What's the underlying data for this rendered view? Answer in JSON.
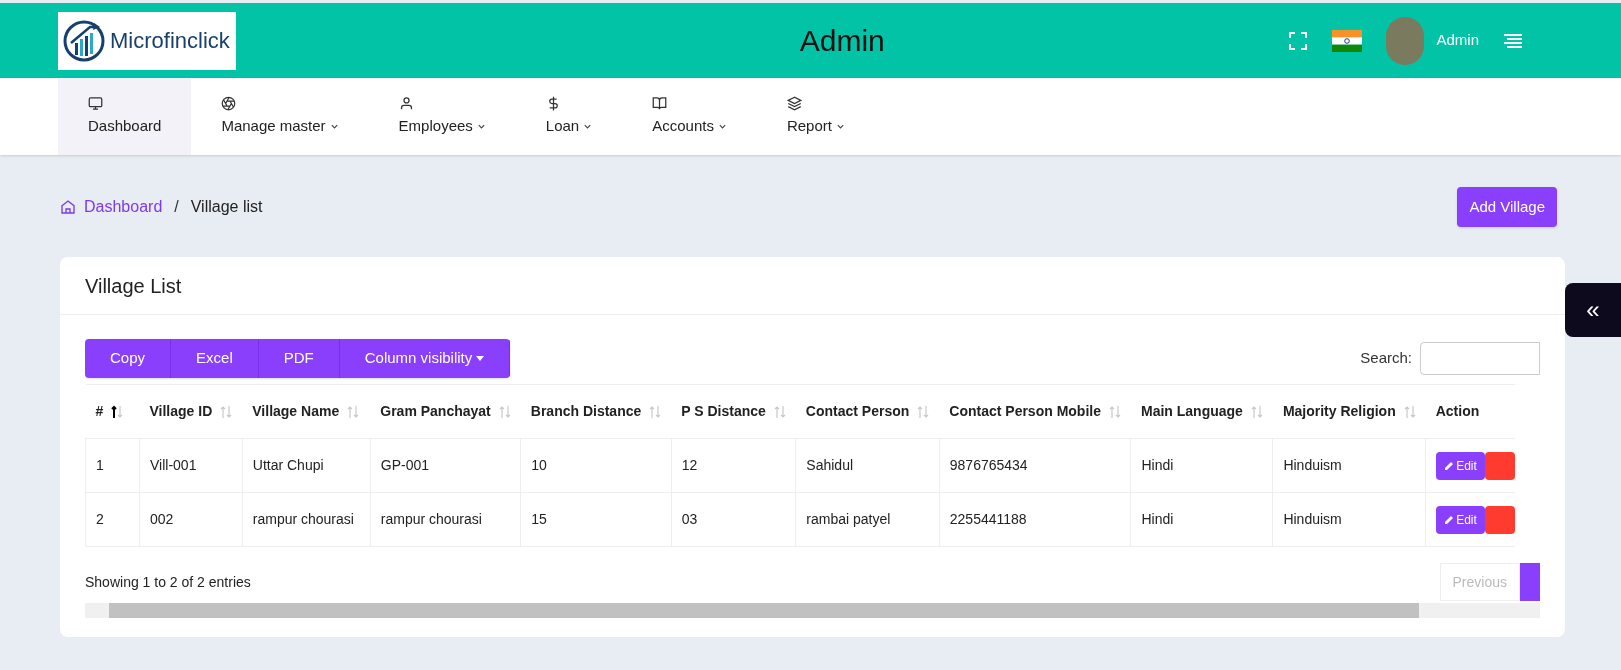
{
  "header": {
    "logo_text": "Microfinclick",
    "title": "Admin",
    "user_name": "Admin"
  },
  "nav": [
    {
      "label": "Dashboard",
      "dropdown": false,
      "selected": true
    },
    {
      "label": "Manage master",
      "dropdown": true,
      "selected": false
    },
    {
      "label": "Employees",
      "dropdown": true,
      "selected": false
    },
    {
      "label": "Loan",
      "dropdown": true,
      "selected": false
    },
    {
      "label": "Accounts",
      "dropdown": true,
      "selected": false
    },
    {
      "label": "Report",
      "dropdown": true,
      "selected": false
    }
  ],
  "breadcrumb": {
    "home": "Dashboard",
    "separator": "/",
    "current": "Village list"
  },
  "add_button": "Add Village",
  "side_toggle": "«",
  "card": {
    "title": "Village List",
    "export_buttons": [
      {
        "label": "Copy",
        "dropdown": false
      },
      {
        "label": "Excel",
        "dropdown": false
      },
      {
        "label": "PDF",
        "dropdown": false
      },
      {
        "label": "Column visibility",
        "dropdown": true
      }
    ],
    "search_label": "Search:",
    "table": {
      "columns": [
        {
          "label": "#",
          "sortable": true,
          "sorted": true
        },
        {
          "label": "Village ID",
          "sortable": true,
          "sorted": false
        },
        {
          "label": "Village Name",
          "sortable": true,
          "sorted": false
        },
        {
          "label": "Gram Panchayat",
          "sortable": true,
          "sorted": false
        },
        {
          "label": "Branch Distance",
          "sortable": true,
          "sorted": false
        },
        {
          "label": "P S Distance",
          "sortable": true,
          "sorted": false
        },
        {
          "label": "Contact Person",
          "sortable": true,
          "sorted": false
        },
        {
          "label": "Contact Person Mobile",
          "sortable": true,
          "sorted": false
        },
        {
          "label": "Main Language",
          "sortable": true,
          "sorted": false
        },
        {
          "label": "Majority Religion",
          "sortable": true,
          "sorted": false
        },
        {
          "label": "Action",
          "sortable": false,
          "sorted": false
        }
      ],
      "rows": [
        {
          "cells": [
            "1",
            "Vill-001",
            "Uttar Chupi",
            "GP-001",
            "10",
            "12",
            "Sahidul",
            "9876765434",
            "Hindi",
            "Hinduism"
          ],
          "edit": "Edit"
        },
        {
          "cells": [
            "2",
            "002",
            "rampur chourasi",
            "rampur chourasi",
            "15",
            "03",
            "rambai patyel",
            "2255441188",
            "Hindi",
            "Hinduism"
          ],
          "edit": "Edit"
        }
      ]
    },
    "info": "Showing 1 to 2 of 2 entries",
    "pagination": {
      "previous": "Previous",
      "previous_disabled": true
    }
  }
}
